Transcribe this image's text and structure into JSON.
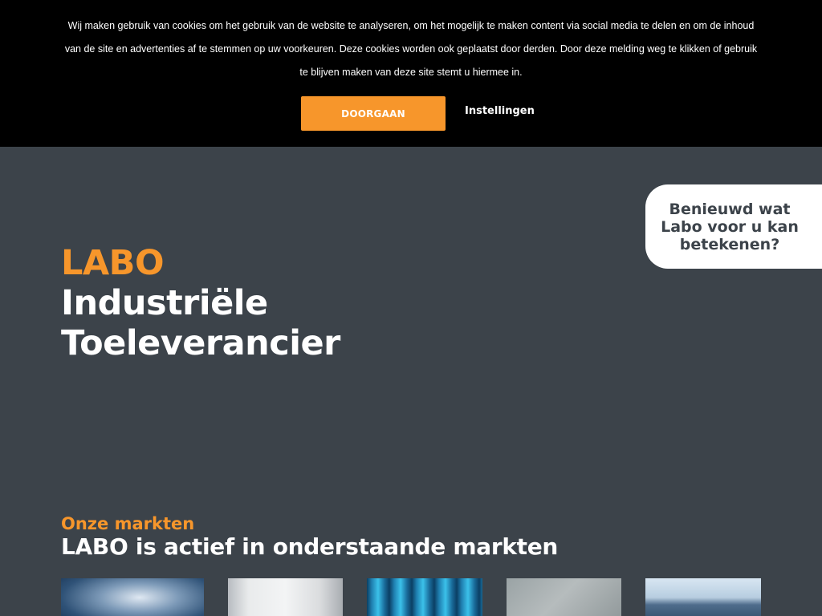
{
  "cookie_banner": {
    "text_line1": "Wij maken gebruik van cookies om het gebruik van de website te analyseren, om het mogelijk te maken content via social media te delen en om de inhoud",
    "text_line2": "van de site en advertenties af te stemmen op uw voorkeuren. Deze cookies worden ook geplaatst door derden. Door deze melding weg te klikken of gebruik",
    "text_line3": "te blijven maken van deze site stemt u hiermee in.",
    "accept_label": "DOORGAAN",
    "settings_label": "Instellingen"
  },
  "hero": {
    "brand": "LABO",
    "line1": "Industriële",
    "line2": "Toeleverancier"
  },
  "cta": {
    "text": "Benieuwd wat Labo voor u kan betekenen?"
  },
  "markets": {
    "kicker": "Onze markten",
    "title": "LABO is actief in onderstaande markten",
    "tiles": [
      {
        "name": "market-tile-1"
      },
      {
        "name": "market-tile-2"
      },
      {
        "name": "market-tile-3"
      },
      {
        "name": "market-tile-4"
      },
      {
        "name": "market-tile-5"
      }
    ]
  },
  "colors": {
    "accent": "#f7962b",
    "background": "#3c434a",
    "banner": "#000000"
  }
}
